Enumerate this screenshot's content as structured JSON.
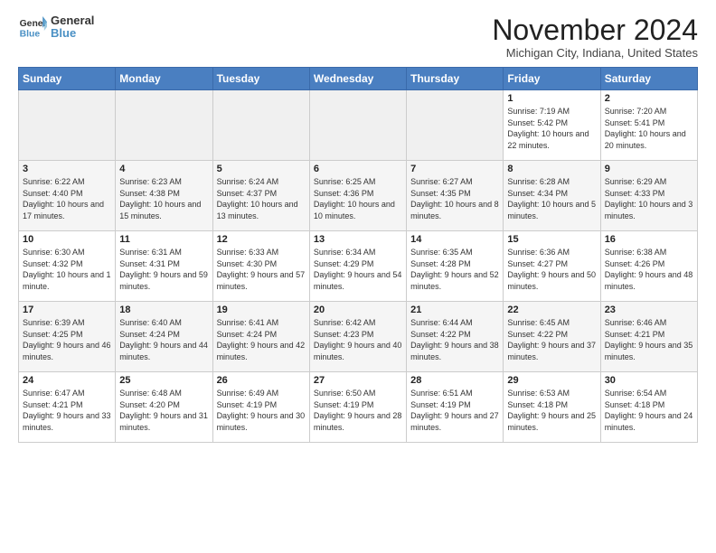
{
  "logo": {
    "line1": "General",
    "line2": "Blue"
  },
  "title": "November 2024",
  "location": "Michigan City, Indiana, United States",
  "days_header": [
    "Sunday",
    "Monday",
    "Tuesday",
    "Wednesday",
    "Thursday",
    "Friday",
    "Saturday"
  ],
  "weeks": [
    [
      {
        "day": "",
        "content": ""
      },
      {
        "day": "",
        "content": ""
      },
      {
        "day": "",
        "content": ""
      },
      {
        "day": "",
        "content": ""
      },
      {
        "day": "",
        "content": ""
      },
      {
        "day": "1",
        "content": "Sunrise: 7:19 AM\nSunset: 5:42 PM\nDaylight: 10 hours\nand 22 minutes."
      },
      {
        "day": "2",
        "content": "Sunrise: 7:20 AM\nSunset: 5:41 PM\nDaylight: 10 hours\nand 20 minutes."
      }
    ],
    [
      {
        "day": "3",
        "content": "Sunrise: 6:22 AM\nSunset: 4:40 PM\nDaylight: 10 hours\nand 17 minutes."
      },
      {
        "day": "4",
        "content": "Sunrise: 6:23 AM\nSunset: 4:38 PM\nDaylight: 10 hours\nand 15 minutes."
      },
      {
        "day": "5",
        "content": "Sunrise: 6:24 AM\nSunset: 4:37 PM\nDaylight: 10 hours\nand 13 minutes."
      },
      {
        "day": "6",
        "content": "Sunrise: 6:25 AM\nSunset: 4:36 PM\nDaylight: 10 hours\nand 10 minutes."
      },
      {
        "day": "7",
        "content": "Sunrise: 6:27 AM\nSunset: 4:35 PM\nDaylight: 10 hours\nand 8 minutes."
      },
      {
        "day": "8",
        "content": "Sunrise: 6:28 AM\nSunset: 4:34 PM\nDaylight: 10 hours\nand 5 minutes."
      },
      {
        "day": "9",
        "content": "Sunrise: 6:29 AM\nSunset: 4:33 PM\nDaylight: 10 hours\nand 3 minutes."
      }
    ],
    [
      {
        "day": "10",
        "content": "Sunrise: 6:30 AM\nSunset: 4:32 PM\nDaylight: 10 hours\nand 1 minute."
      },
      {
        "day": "11",
        "content": "Sunrise: 6:31 AM\nSunset: 4:31 PM\nDaylight: 9 hours\nand 59 minutes."
      },
      {
        "day": "12",
        "content": "Sunrise: 6:33 AM\nSunset: 4:30 PM\nDaylight: 9 hours\nand 57 minutes."
      },
      {
        "day": "13",
        "content": "Sunrise: 6:34 AM\nSunset: 4:29 PM\nDaylight: 9 hours\nand 54 minutes."
      },
      {
        "day": "14",
        "content": "Sunrise: 6:35 AM\nSunset: 4:28 PM\nDaylight: 9 hours\nand 52 minutes."
      },
      {
        "day": "15",
        "content": "Sunrise: 6:36 AM\nSunset: 4:27 PM\nDaylight: 9 hours\nand 50 minutes."
      },
      {
        "day": "16",
        "content": "Sunrise: 6:38 AM\nSunset: 4:26 PM\nDaylight: 9 hours\nand 48 minutes."
      }
    ],
    [
      {
        "day": "17",
        "content": "Sunrise: 6:39 AM\nSunset: 4:25 PM\nDaylight: 9 hours\nand 46 minutes."
      },
      {
        "day": "18",
        "content": "Sunrise: 6:40 AM\nSunset: 4:24 PM\nDaylight: 9 hours\nand 44 minutes."
      },
      {
        "day": "19",
        "content": "Sunrise: 6:41 AM\nSunset: 4:24 PM\nDaylight: 9 hours\nand 42 minutes."
      },
      {
        "day": "20",
        "content": "Sunrise: 6:42 AM\nSunset: 4:23 PM\nDaylight: 9 hours\nand 40 minutes."
      },
      {
        "day": "21",
        "content": "Sunrise: 6:44 AM\nSunset: 4:22 PM\nDaylight: 9 hours\nand 38 minutes."
      },
      {
        "day": "22",
        "content": "Sunrise: 6:45 AM\nSunset: 4:22 PM\nDaylight: 9 hours\nand 37 minutes."
      },
      {
        "day": "23",
        "content": "Sunrise: 6:46 AM\nSunset: 4:21 PM\nDaylight: 9 hours\nand 35 minutes."
      }
    ],
    [
      {
        "day": "24",
        "content": "Sunrise: 6:47 AM\nSunset: 4:21 PM\nDaylight: 9 hours\nand 33 minutes."
      },
      {
        "day": "25",
        "content": "Sunrise: 6:48 AM\nSunset: 4:20 PM\nDaylight: 9 hours\nand 31 minutes."
      },
      {
        "day": "26",
        "content": "Sunrise: 6:49 AM\nSunset: 4:19 PM\nDaylight: 9 hours\nand 30 minutes."
      },
      {
        "day": "27",
        "content": "Sunrise: 6:50 AM\nSunset: 4:19 PM\nDaylight: 9 hours\nand 28 minutes."
      },
      {
        "day": "28",
        "content": "Sunrise: 6:51 AM\nSunset: 4:19 PM\nDaylight: 9 hours\nand 27 minutes."
      },
      {
        "day": "29",
        "content": "Sunrise: 6:53 AM\nSunset: 4:18 PM\nDaylight: 9 hours\nand 25 minutes."
      },
      {
        "day": "30",
        "content": "Sunrise: 6:54 AM\nSunset: 4:18 PM\nDaylight: 9 hours\nand 24 minutes."
      }
    ]
  ]
}
